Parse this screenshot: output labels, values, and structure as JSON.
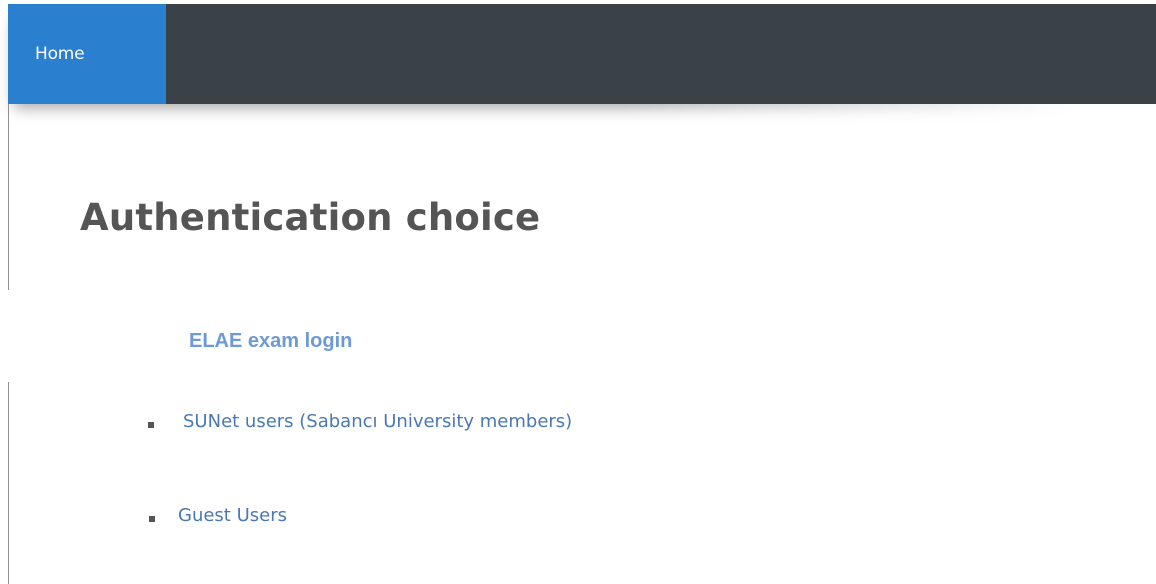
{
  "navbar": {
    "home_label": "Home"
  },
  "page": {
    "title": "Authentication choice",
    "subtitle": "ELAE exam login"
  },
  "options": [
    {
      "label": "SUNet users (Sabancı University members)"
    },
    {
      "label": "Guest Users"
    }
  ],
  "colors": {
    "navbar_bg": "#3a4248",
    "home_tab_bg": "#2b7fcf",
    "title_text": "#555555",
    "subtitle_text": "#6d9ad6",
    "link_text": "#4a78b3"
  }
}
